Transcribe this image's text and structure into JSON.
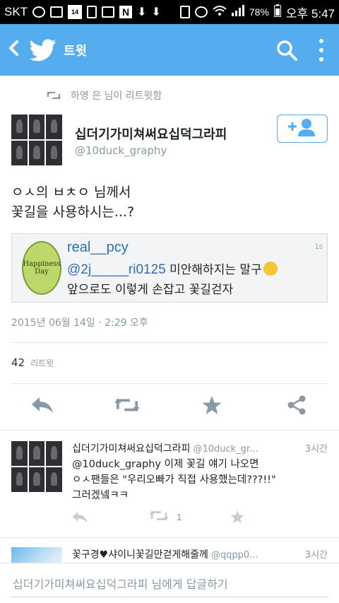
{
  "status_bar": {
    "carrier": "SKT",
    "calendar_day": "14",
    "battery": "78%",
    "time": "오후 5:47"
  },
  "app_bar": {
    "title": "트윗",
    "color": "#55acee"
  },
  "retweet_header": {
    "text": "하영 은 님이 리트윗함"
  },
  "tweet": {
    "author_name": "십더기가미쳐써요십덕그라피",
    "author_handle": "@10duck_graphy",
    "text_line1": "ㅇㅅ의 ㅂㅊㅇ 님께서",
    "text_line2": "꽃길을 사용하시는...?",
    "media": {
      "logo_text": "Happiness Day",
      "user": "real__pcy",
      "time": "1s",
      "mention": "@2j_____ri0125",
      "line1_text": " 미안해하지는 말구",
      "line2_text": "앞으로도 이렇게 손잡고 꽃길걷자"
    },
    "timestamp": "2015년 06월 14일 · 2:29 오후",
    "retweet_count": "42",
    "retweet_label": "리트윗"
  },
  "replies": [
    {
      "name": "십더기가미쳐써요십덕그라피",
      "handle": "@10duck_gr...",
      "time": "3시간",
      "line1": "@10duck_graphy 이제 꽃길 얘기 나오면",
      "line2": "ㅇㅅ팬들은 \"우리오빠가 직접 사용했는데???!!\"",
      "line3": "그러겠넼ㅋㅋ",
      "retweet_count": "1"
    },
    {
      "name": "꽃구경♥샤이니꽃길만걷게해줄께",
      "handle": "@qqpp0...",
      "time": "3시간"
    }
  ],
  "reply_bar": {
    "placeholder": "십더기가미쳐써요십덕그라피 님에게 답글하기"
  },
  "icons": {
    "back": "back-arrow-icon",
    "logo": "twitter-bird-icon",
    "search": "search-icon",
    "more": "more-vertical-icon",
    "follow": "add-user-icon",
    "reply": "reply-icon",
    "retweet": "retweet-icon",
    "favorite": "star-icon",
    "share": "share-icon"
  }
}
